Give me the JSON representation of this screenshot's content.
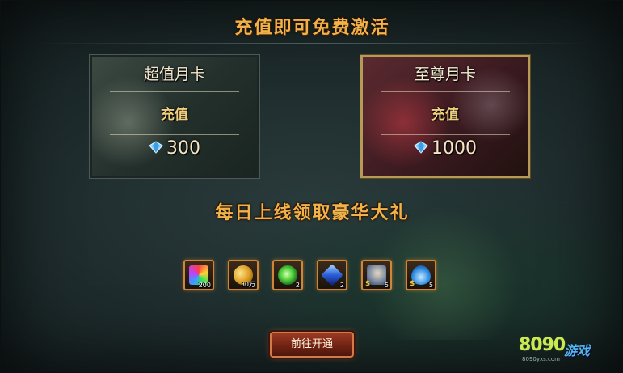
{
  "header": {
    "title": "充值即可免费激活"
  },
  "cards": [
    {
      "title": "超值月卡",
      "subtitle": "充值",
      "price": "300"
    },
    {
      "title": "至尊月卡",
      "subtitle": "充值",
      "price": "1000"
    }
  ],
  "rewards": {
    "title": "每日上线领取豪华大礼",
    "items": [
      {
        "icon": "rainbow-gem-icon",
        "count": "200"
      },
      {
        "icon": "gold-coins-icon",
        "count": "30万"
      },
      {
        "icon": "green-orb-icon",
        "count": "2"
      },
      {
        "icon": "blue-crystal-icon",
        "count": "2"
      },
      {
        "icon": "hero-soul-icon",
        "count": "5"
      },
      {
        "icon": "water-drop-icon",
        "count": "5"
      }
    ]
  },
  "action": {
    "button_label": "前往开通"
  },
  "watermark": {
    "number": "8090",
    "text": "游戏",
    "url": "8090yxs.com"
  },
  "colors": {
    "accent": "#f2b24a",
    "button": "#8a2f1c",
    "item_border": "#d08636"
  }
}
